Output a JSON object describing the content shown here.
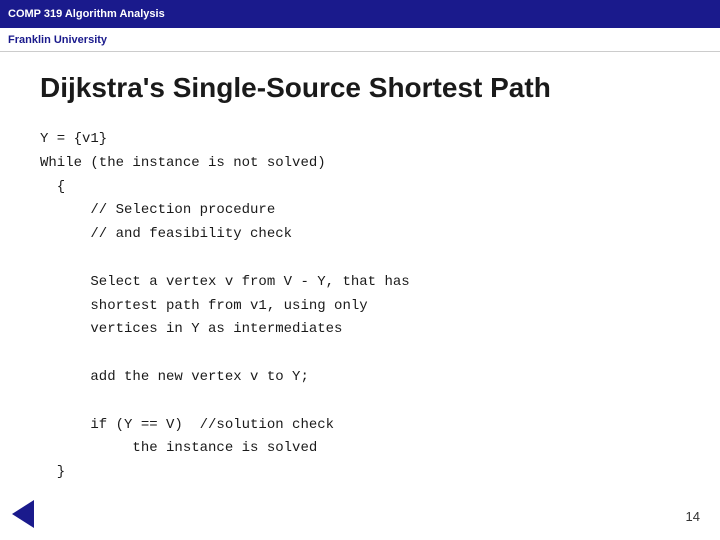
{
  "topbar": {
    "title": "COMP 319 Algorithm Analysis",
    "subtitle": "Franklin University"
  },
  "slide": {
    "title": "Dijkstra's Single-Source Shortest Path",
    "code_lines": [
      "Y = {v1}",
      "While (the instance is not solved)",
      "  {",
      "      // Selection procedure",
      "      // and feasibility check",
      "",
      "      Select a vertex v from V - Y, that has",
      "      shortest path from v1, using only",
      "      vertices in Y as intermediates",
      "",
      "      add the new vertex v to Y;",
      "",
      "      if (Y == V)  //solution check",
      "           the instance is solved",
      "  }"
    ]
  },
  "page_number": "14"
}
